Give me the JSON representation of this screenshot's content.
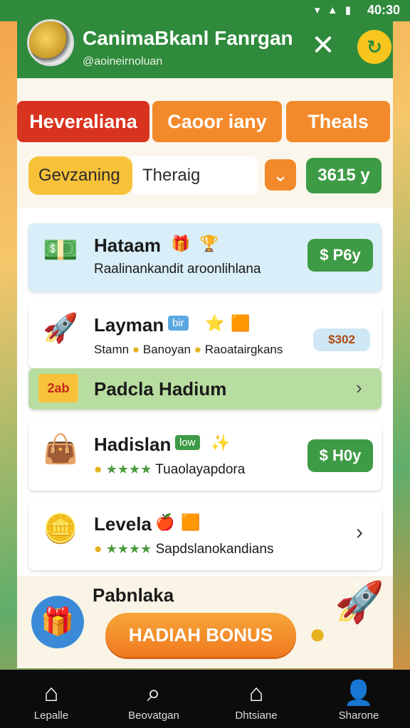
{
  "status": {
    "time": "40:30",
    "icons": "▾ ▲ ▮"
  },
  "header": {
    "title": "CanimaBkanl Fanrgan",
    "subtitle": "@aoineirnoluan",
    "close_icon": "close-icon",
    "sync_icon": "sync-icon"
  },
  "tabs": [
    {
      "label": "Heveraliana"
    },
    {
      "label": "Caoor iany"
    },
    {
      "label": "Theals"
    }
  ],
  "filter": {
    "chip_label": "Gevzaning",
    "input_value": "Theraig",
    "balance": "3615 y"
  },
  "items": [
    {
      "title": "Hataam",
      "subtitle": "Raalinankandit aroonlihlana",
      "price": "$ P6y",
      "icon": "money-icon"
    },
    {
      "title": "Layman",
      "tag": "bir",
      "subtitle_a": "Stamn",
      "subtitle_b": "Banoyan",
      "subtitle_c": "Raoatairgkans",
      "chip": "$302",
      "icon": "rocket-icon"
    },
    {
      "title": "Padcla Hadium",
      "icon": "ticket-icon",
      "sticker": "2ab"
    },
    {
      "title": "Hadislan",
      "tag": "low",
      "subtitle": "Tuaolayapdora",
      "price": "$ H0y",
      "icon": "bag-icon"
    },
    {
      "title": "Levela",
      "subtitle": "Sapdslanokandians",
      "icon": "coin-icon"
    }
  ],
  "promo": {
    "title": "Pabnlaka",
    "button": "HADIAH BONUS"
  },
  "nav": [
    {
      "label": "Lepalle",
      "icon": "home-icon"
    },
    {
      "label": "Beovatgan",
      "icon": "search-icon"
    },
    {
      "label": "Dhtsiane",
      "icon": "house-icon"
    },
    {
      "label": "Sharone",
      "icon": "user-icon"
    }
  ],
  "colors": {
    "primary_green": "#2f8a3c",
    "accent_orange": "#f28a2b",
    "accent_red": "#d8331f",
    "gold": "#f7c51e"
  }
}
